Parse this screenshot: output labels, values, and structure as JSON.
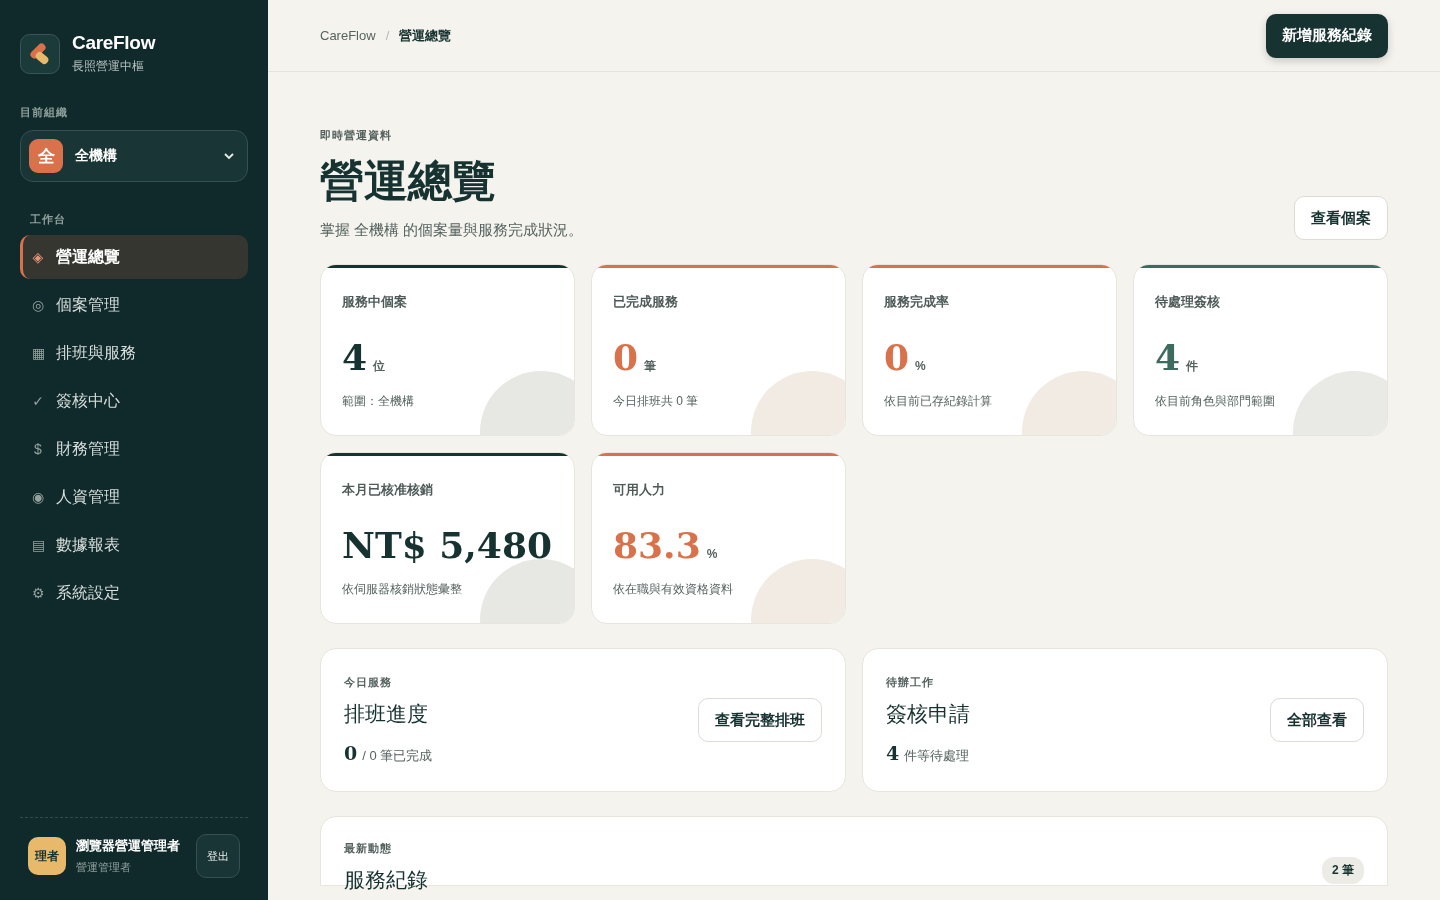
{
  "brand": {
    "name": "CareFlow",
    "subtitle": "長照營運中樞"
  },
  "org": {
    "label": "目前組織",
    "badge": "全",
    "name": "全機構"
  },
  "nav": {
    "section": "工作台",
    "items": [
      {
        "icon": "◈",
        "label": "營運總覽",
        "selected": true
      },
      {
        "icon": "◎",
        "label": "個案管理",
        "selected": false
      },
      {
        "icon": "▦",
        "label": "排班與服務",
        "selected": false
      },
      {
        "icon": "✓",
        "label": "簽核中心",
        "selected": false
      },
      {
        "icon": "$",
        "label": "財務管理",
        "selected": false
      },
      {
        "icon": "◉",
        "label": "人資管理",
        "selected": false
      },
      {
        "icon": "▤",
        "label": "數據報表",
        "selected": false
      },
      {
        "icon": "⚙",
        "label": "系統設定",
        "selected": false
      }
    ]
  },
  "user": {
    "avatar": "理者",
    "name": "瀏覽器營運管理者",
    "role": "營運管理者",
    "logout": "登出"
  },
  "breadcrumb": [
    "CareFlow",
    "營運總覽"
  ],
  "breadcrumb_separator": "/",
  "primary_button": "新增服務紀錄",
  "page": {
    "eyebrow": "即時營運資料",
    "title": "營運總覽",
    "description": "掌握 全機構 的個案量與服務完成狀況。",
    "action": "查看個案"
  },
  "stats": [
    {
      "label": "服務中個案",
      "value": "4",
      "unit": "位",
      "note": "範圍：全機構",
      "color": "#173331"
    },
    {
      "label": "已完成服務",
      "value": "0",
      "unit": "筆",
      "note": "今日排班共 0 筆",
      "color": "#d9714a"
    },
    {
      "label": "服務完成率",
      "value": "0",
      "unit": "%",
      "note": "依目前已存紀錄計算",
      "color": "#d9714a"
    },
    {
      "label": "待處理簽核",
      "value": "4",
      "unit": "件",
      "note": "依目前角色與部門範圍",
      "color": "#3d6b60"
    },
    {
      "label": "本月已核准核銷",
      "value": "NT$ 5,480",
      "note": "依伺服器核銷狀態彙整",
      "color": "#173331"
    },
    {
      "label": "可用人力",
      "value": "83.3",
      "unit": "%",
      "note": "依在職與有效資格資料",
      "color": "#d9714a"
    }
  ],
  "panels": [
    {
      "eyebrow": "今日服務",
      "title": "排班進度",
      "count": "0",
      "text": "/ 0 筆已完成",
      "button": "查看完整排班"
    },
    {
      "eyebrow": "待辦工作",
      "title": "簽核申請",
      "count": "4",
      "text": "件等待處理",
      "button": "全部查看"
    }
  ],
  "activity": {
    "eyebrow": "最新動態",
    "title": "服務紀錄",
    "badge": "2 筆"
  }
}
